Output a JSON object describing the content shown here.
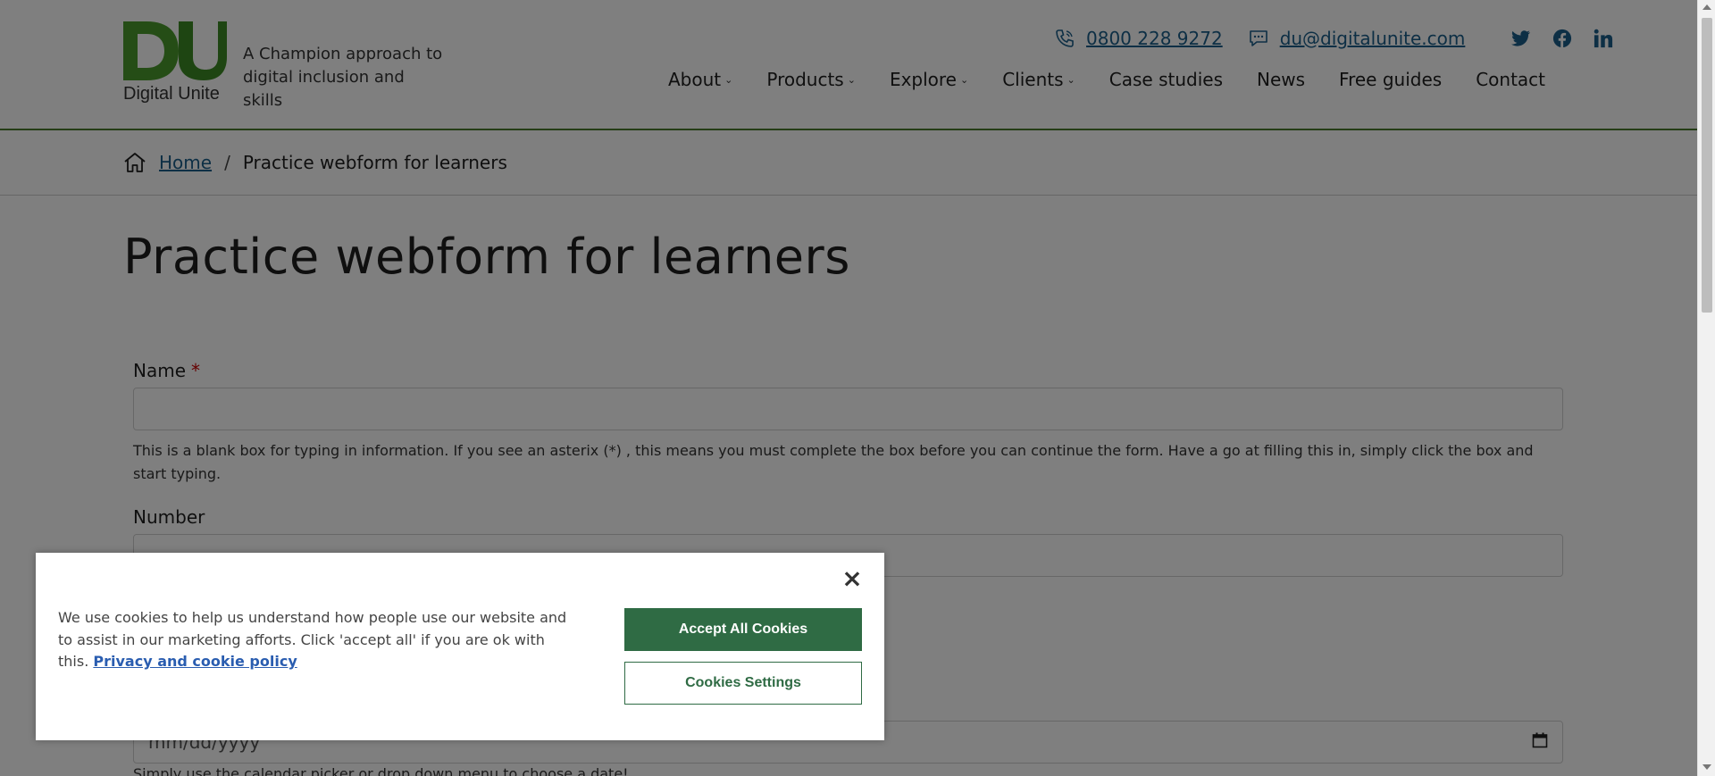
{
  "header": {
    "logo_text": "Digital Unite",
    "tagline": "A Champion approach to digital inclusion and skills",
    "phone": "0800 228 9272",
    "email": "du@digitalunite.com",
    "social": [
      "twitter-icon",
      "facebook-icon",
      "linkedin-icon"
    ]
  },
  "nav": {
    "items": [
      {
        "label": "About",
        "has_dropdown": true
      },
      {
        "label": "Products",
        "has_dropdown": true
      },
      {
        "label": "Explore",
        "has_dropdown": true
      },
      {
        "label": "Clients",
        "has_dropdown": true
      },
      {
        "label": "Case studies",
        "has_dropdown": false
      },
      {
        "label": "News",
        "has_dropdown": false
      },
      {
        "label": "Free guides",
        "has_dropdown": false
      },
      {
        "label": "Contact",
        "has_dropdown": false
      }
    ]
  },
  "breadcrumb": {
    "home": "Home",
    "separator": "/",
    "current": "Practice webform for learners"
  },
  "page": {
    "title": "Practice webform for learners"
  },
  "form": {
    "name_label": "Name",
    "required_mark": "*",
    "name_help": "This is a blank box for typing in information. If you see an asterix (*) , this means you must complete the box before you can continue the form. Have a go at filling this in, simply click the box and start typing.",
    "number_label": "Number",
    "date_placeholder": "mm/dd/yyyy",
    "date_help": "Simply use the calendar picker or drop down menu to choose a date!"
  },
  "cookie": {
    "text": "We use cookies to help us understand how people use our website and to assist in our marketing afforts. Click 'accept all' if you are ok with this.",
    "policy_link": "Privacy and cookie policy",
    "accept_label": "Accept All Cookies",
    "settings_label": "Cookies Settings",
    "close": "×"
  },
  "colors": {
    "brand_green": "#4a9a2c",
    "accept_button": "#2f6b44",
    "link": "#1b5e8a"
  }
}
